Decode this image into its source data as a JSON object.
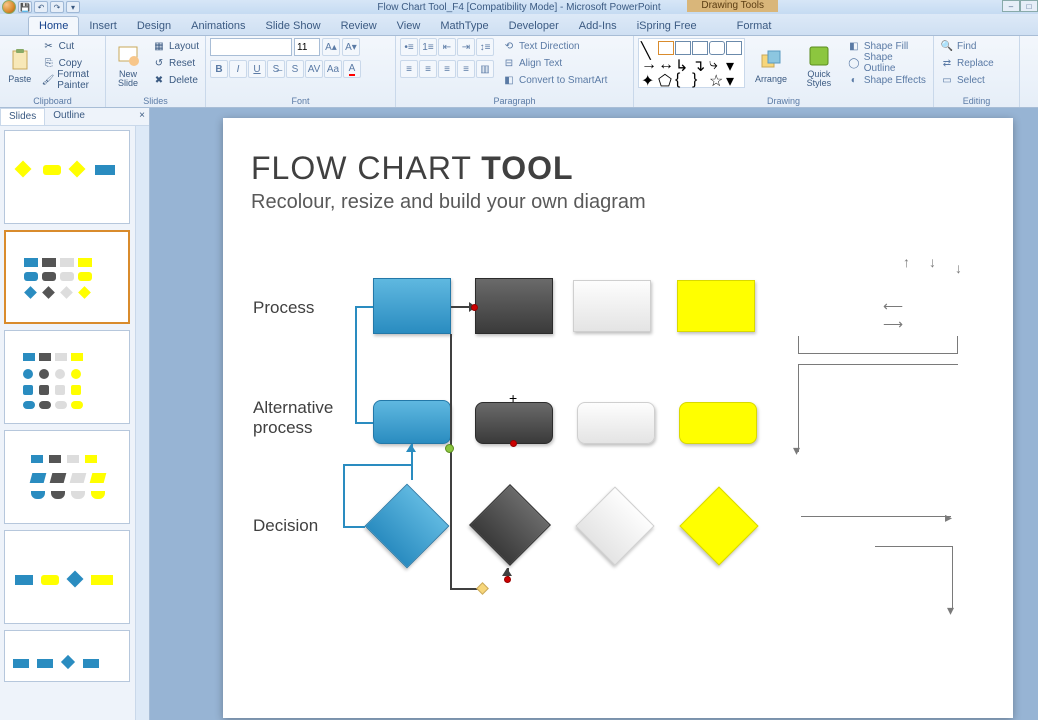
{
  "app": {
    "title": "Flow Chart Tool_F4 [Compatibility Mode] - Microsoft PowerPoint",
    "context_tab": "Drawing Tools"
  },
  "tabs": {
    "items": [
      "Home",
      "Insert",
      "Design",
      "Animations",
      "Slide Show",
      "Review",
      "View",
      "MathType",
      "Developer",
      "Add-Ins",
      "iSpring Free",
      "Format"
    ],
    "active": 0
  },
  "ribbon": {
    "clipboard": {
      "label": "Clipboard",
      "paste": "Paste",
      "cut": "Cut",
      "copy": "Copy",
      "format_painter": "Format Painter"
    },
    "slides": {
      "label": "Slides",
      "new_slide": "New Slide",
      "layout": "Layout",
      "reset": "Reset",
      "delete": "Delete"
    },
    "font": {
      "label": "Font",
      "name_value": "",
      "size_value": "11"
    },
    "paragraph": {
      "label": "Paragraph",
      "text_direction": "Text Direction",
      "align_text": "Align Text",
      "smartart": "Convert to SmartArt"
    },
    "drawing": {
      "label": "Drawing",
      "arrange": "Arrange",
      "quick_styles": "Quick Styles",
      "shape_fill": "Shape Fill",
      "shape_outline": "Shape Outline",
      "shape_effects": "Shape Effects"
    },
    "editing": {
      "label": "Editing",
      "find": "Find",
      "replace": "Replace",
      "select": "Select"
    }
  },
  "thumbs_pane": {
    "tabs": {
      "slides": "Slides",
      "outline": "Outline"
    },
    "selected_index": 1
  },
  "slide": {
    "title_prefix": "FLOW CHART ",
    "title_bold": "TOOL",
    "subtitle": "Recolour, resize and build your own diagram",
    "rows": {
      "process": "Process",
      "alt_process": "Alternative process",
      "decision": "Decision"
    }
  },
  "colors": {
    "blue": "#2a8cc0",
    "dark": "#3a3a3a",
    "grey": "#e4e4e4",
    "yellow": "#ffff00"
  }
}
